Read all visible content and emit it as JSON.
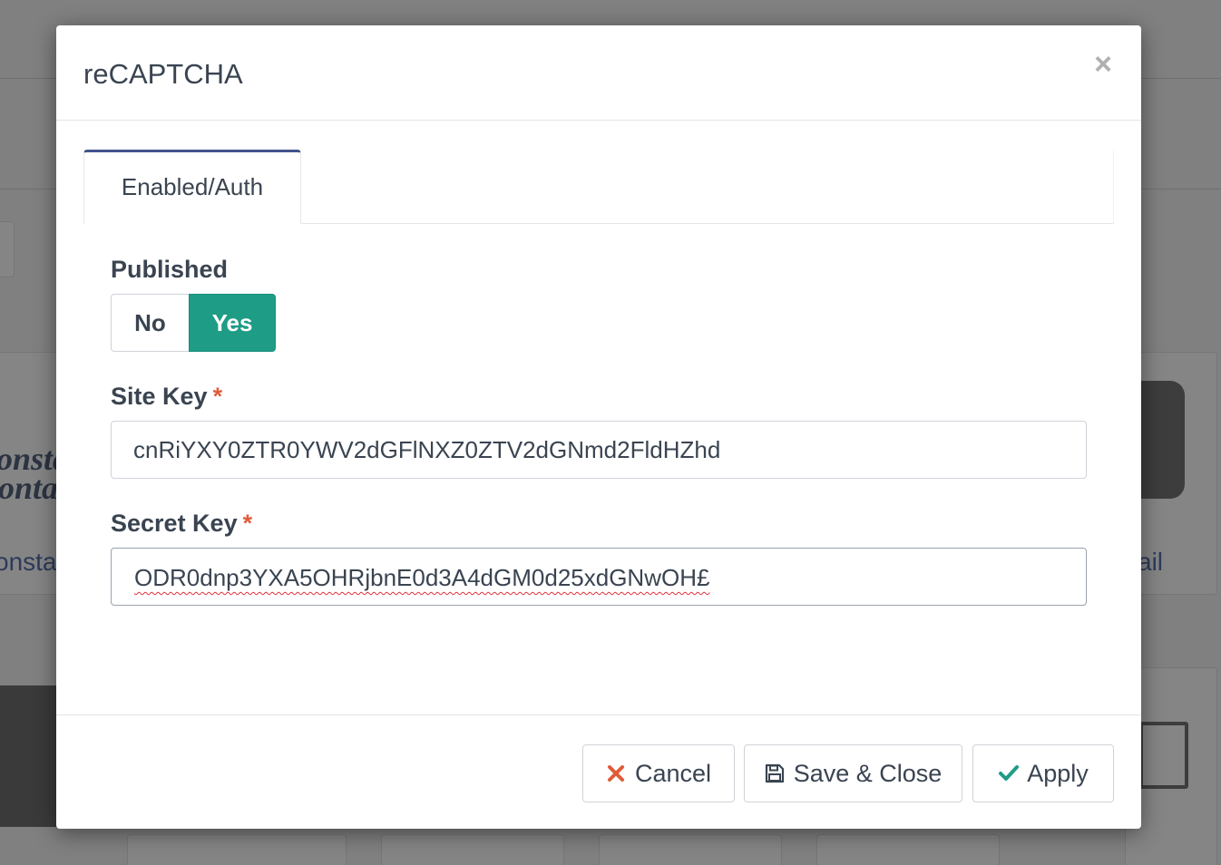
{
  "modal": {
    "title": "reCAPTCHA",
    "close_label": "×"
  },
  "tabs": [
    {
      "label": "Enabled/Auth",
      "active": true
    }
  ],
  "form": {
    "published": {
      "label": "Published",
      "options": [
        "No",
        "Yes"
      ],
      "selected": "Yes"
    },
    "site_key": {
      "label": "Site Key",
      "required_mark": "*",
      "value": "cnRiYXY0ZTR0YWV2dGFlNXZ0ZTV2dGNmd2FldHZhd"
    },
    "secret_key": {
      "label": "Secret Key",
      "required_mark": "*",
      "value": "ODR0dnp3YXA5OHRjbnE0d3A4dGM0d25xdGNwOH£"
    }
  },
  "footer": {
    "cancel_label": "Cancel",
    "save_close_label": "Save & Close",
    "apply_label": "Apply"
  },
  "background": {
    "logo_text_1": "onsta",
    "logo_text_2": "onta",
    "link_left": "onsta",
    "link_right": "ail"
  },
  "colors": {
    "accent_tab": "#42538b",
    "toggle_yes": "#1e9c86",
    "required": "#e05b3a",
    "cancel_icon": "#e05b3a",
    "apply_icon": "#1e9c86"
  }
}
